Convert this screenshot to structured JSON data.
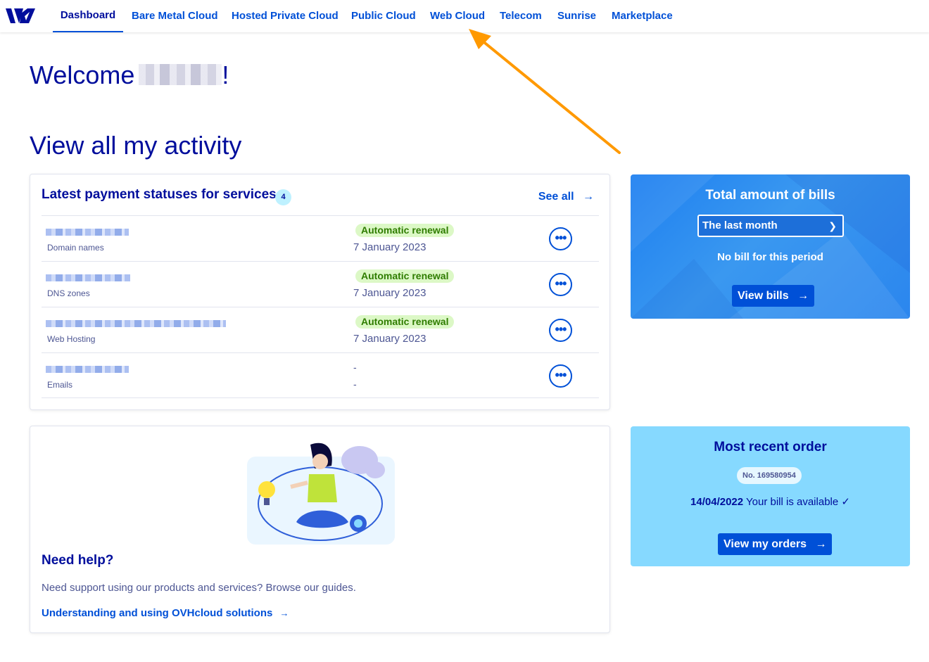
{
  "nav": {
    "items": [
      {
        "label": "Dashboard",
        "active": true
      },
      {
        "label": "Bare Metal Cloud"
      },
      {
        "label": "Hosted Private Cloud"
      },
      {
        "label": "Public Cloud"
      },
      {
        "label": "Web Cloud"
      },
      {
        "label": "Telecom"
      },
      {
        "label": "Sunrise"
      },
      {
        "label": "Marketplace"
      }
    ]
  },
  "welcome": {
    "prefix": "Welcome",
    "suffix": "!"
  },
  "activity": {
    "title": "View all my activity"
  },
  "payments": {
    "title": "Latest payment statuses for services",
    "count": "4",
    "see_all": "See all",
    "rows": [
      {
        "type": "Domain names",
        "status": "Automatic renewal",
        "date": "7 January 2023"
      },
      {
        "type": "DNS zones",
        "status": "Automatic renewal",
        "date": "7 January 2023"
      },
      {
        "type": "Web Hosting",
        "status": "Automatic renewal",
        "date": "7 January 2023"
      },
      {
        "type": "Emails",
        "status": "-",
        "date": "-"
      }
    ]
  },
  "bills": {
    "title": "Total amount of bills",
    "period": "The last month",
    "empty": "No bill for this period",
    "button": "View bills"
  },
  "help": {
    "title": "Need help?",
    "text": "Need support using our products and services? Browse our guides.",
    "link": "Understanding and using OVHcloud solutions"
  },
  "order": {
    "title": "Most recent order",
    "number": "No. 169580954",
    "date": "14/04/2022",
    "status": "Your bill is available",
    "button": "View my orders"
  },
  "colors": {
    "brand": "#000e9c",
    "accent": "#0050d7",
    "annotation_arrow": "#ff9900"
  }
}
